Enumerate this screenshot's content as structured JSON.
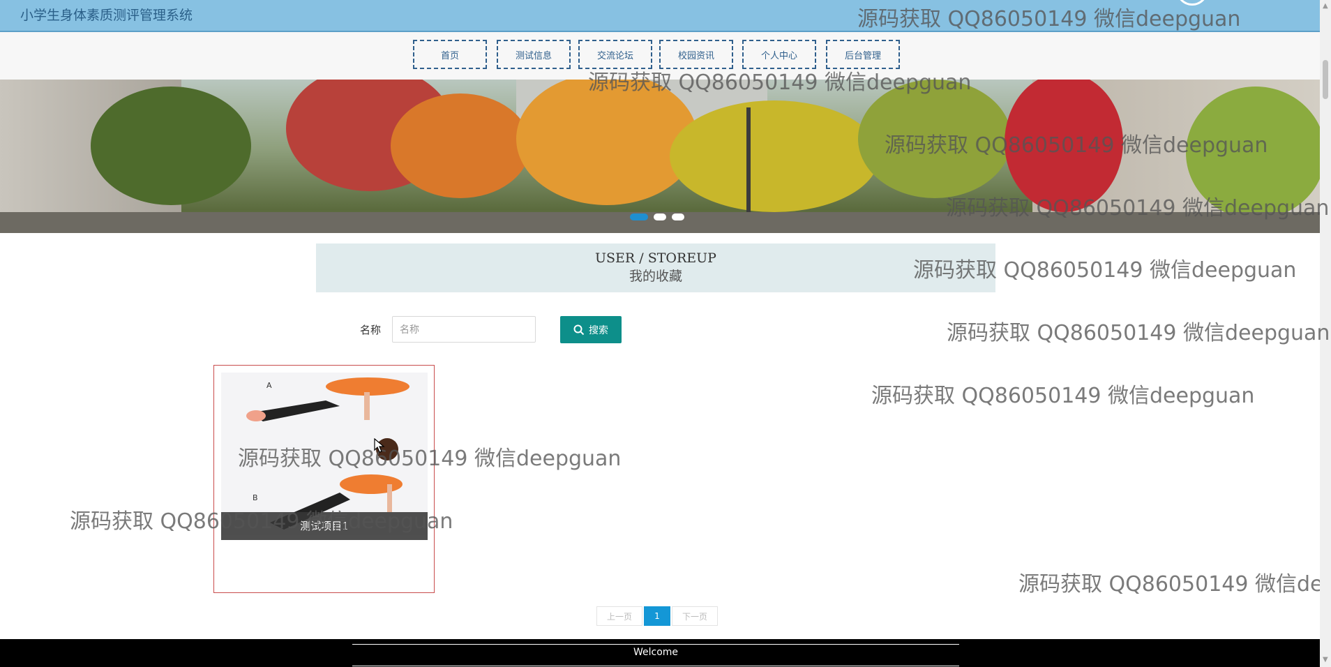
{
  "header": {
    "site_title": "小学生身体素质测评管理系统"
  },
  "nav": {
    "items": [
      {
        "label": "首页"
      },
      {
        "label": "测试信息"
      },
      {
        "label": "交流论坛"
      },
      {
        "label": "校园资讯"
      },
      {
        "label": "个人中心"
      },
      {
        "label": "后台管理"
      }
    ]
  },
  "carousel": {
    "slide_count": 3,
    "active_index": 0
  },
  "section": {
    "title_en": "USER / STOREUP",
    "title_cn": "我的收藏"
  },
  "search": {
    "label": "名称",
    "placeholder": "名称",
    "value": "",
    "button_label": "搜索"
  },
  "items": [
    {
      "title": "测试项目1"
    }
  ],
  "pagination": {
    "prev_label": "上一页",
    "current_page": "1",
    "next_label": "下一页"
  },
  "footer": {
    "text": "Welcome"
  },
  "watermark": {
    "text": "源码获取 QQ86050149 微信deepguan"
  },
  "colors": {
    "header_bg": "#87c1e2",
    "nav_border": "#2f5f8c",
    "search_button": "#0d8f8a",
    "active_page": "#1497d6",
    "card_border": "#c94c4c",
    "footer_bg": "#000000"
  }
}
